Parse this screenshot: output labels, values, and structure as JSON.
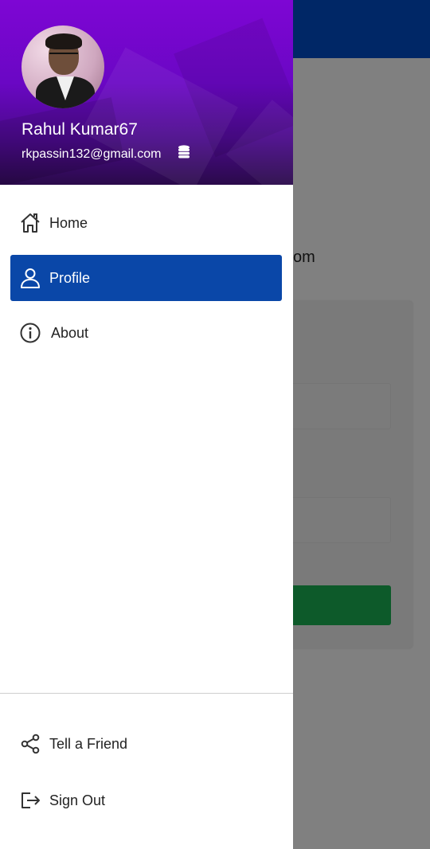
{
  "background": {
    "partial_text": "om"
  },
  "drawer": {
    "user": {
      "name": "Rahul Kumar67",
      "email": "rkpassin132@gmail.com",
      "coins_icon": "coins-icon"
    },
    "menu": [
      {
        "label": "Home",
        "icon": "home-icon",
        "active": false
      },
      {
        "label": "Profile",
        "icon": "user-icon",
        "active": true
      },
      {
        "label": "About",
        "icon": "info-icon",
        "active": false
      }
    ],
    "footer": [
      {
        "label": "Tell a Friend",
        "icon": "share-icon"
      },
      {
        "label": "Sign Out",
        "icon": "sign-out-icon"
      }
    ]
  },
  "colors": {
    "header_gradient_top": "#7e06d4",
    "active_item": "#0a47a8",
    "topbar": "#002766",
    "bg_button": "#0d5a2a"
  }
}
